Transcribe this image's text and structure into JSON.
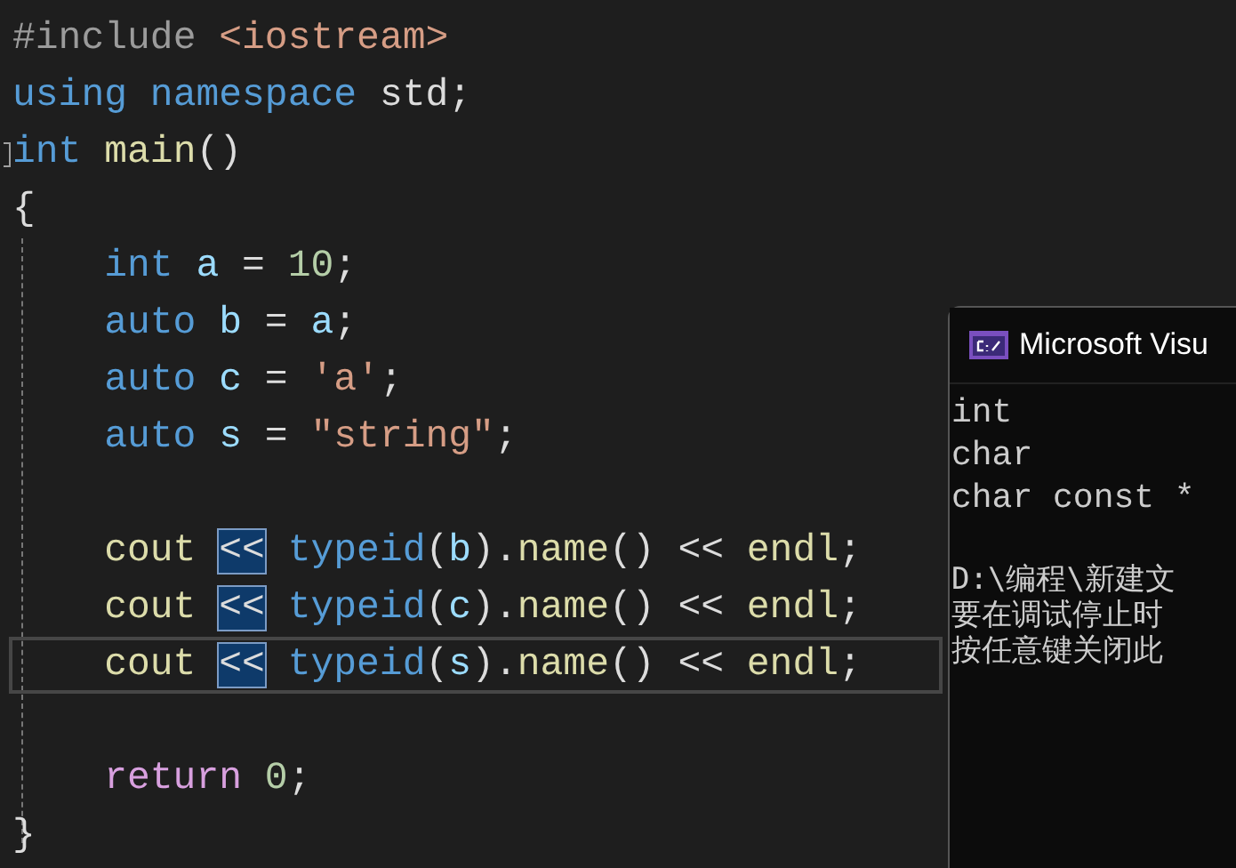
{
  "editor": {
    "lines": [
      {
        "current": false,
        "fold_marker": false,
        "indented": false,
        "tokens": [
          {
            "kind": "preproc",
            "text": "#include "
          },
          {
            "kind": "string",
            "text": "<iostream>"
          }
        ]
      },
      {
        "current": false,
        "fold_marker": false,
        "indented": false,
        "tokens": [
          {
            "kind": "keyword",
            "text": "using namespace "
          },
          {
            "kind": "plain",
            "text": "std;"
          }
        ]
      },
      {
        "current": false,
        "fold_marker": true,
        "indented": false,
        "tokens": [
          {
            "kind": "keyword",
            "text": "int "
          },
          {
            "kind": "function",
            "text": "main"
          },
          {
            "kind": "plain",
            "text": "()"
          }
        ]
      },
      {
        "current": false,
        "fold_marker": false,
        "indented": false,
        "tokens": [
          {
            "kind": "plain",
            "text": "{"
          }
        ]
      },
      {
        "current": false,
        "fold_marker": false,
        "indented": true,
        "tokens": [
          {
            "kind": "keyword",
            "text": "int "
          },
          {
            "kind": "variable",
            "text": "a"
          },
          {
            "kind": "plain",
            "text": " = "
          },
          {
            "kind": "number",
            "text": "10"
          },
          {
            "kind": "plain",
            "text": ";"
          }
        ]
      },
      {
        "current": false,
        "fold_marker": false,
        "indented": true,
        "tokens": [
          {
            "kind": "keyword",
            "text": "auto "
          },
          {
            "kind": "variable",
            "text": "b"
          },
          {
            "kind": "plain",
            "text": " = "
          },
          {
            "kind": "variable",
            "text": "a"
          },
          {
            "kind": "plain",
            "text": ";"
          }
        ]
      },
      {
        "current": false,
        "fold_marker": false,
        "indented": true,
        "tokens": [
          {
            "kind": "keyword",
            "text": "auto "
          },
          {
            "kind": "variable",
            "text": "c"
          },
          {
            "kind": "plain",
            "text": " = "
          },
          {
            "kind": "string",
            "text": "'a'"
          },
          {
            "kind": "plain",
            "text": ";"
          }
        ]
      },
      {
        "current": false,
        "fold_marker": false,
        "indented": true,
        "tokens": [
          {
            "kind": "keyword",
            "text": "auto "
          },
          {
            "kind": "variable",
            "text": "s"
          },
          {
            "kind": "plain",
            "text": " = "
          },
          {
            "kind": "string",
            "text": "\"string\""
          },
          {
            "kind": "plain",
            "text": ";"
          }
        ]
      },
      {
        "current": false,
        "fold_marker": false
      },
      {
        "current": false,
        "fold_marker": false,
        "indented": true,
        "tokens": [
          {
            "kind": "function",
            "text": "cout "
          },
          {
            "kind": "match",
            "text": "<<"
          },
          {
            "kind": "keyword",
            "text": " typeid"
          },
          {
            "kind": "plain",
            "text": "("
          },
          {
            "kind": "variable",
            "text": "b"
          },
          {
            "kind": "plain",
            "text": ")."
          },
          {
            "kind": "function",
            "text": "name"
          },
          {
            "kind": "plain",
            "text": "() << "
          },
          {
            "kind": "function",
            "text": "endl"
          },
          {
            "kind": "plain",
            "text": ";"
          }
        ]
      },
      {
        "current": false,
        "fold_marker": false,
        "indented": true,
        "tokens": [
          {
            "kind": "function",
            "text": "cout "
          },
          {
            "kind": "match",
            "text": "<<"
          },
          {
            "kind": "keyword",
            "text": " typeid"
          },
          {
            "kind": "plain",
            "text": "("
          },
          {
            "kind": "variable",
            "text": "c"
          },
          {
            "kind": "plain",
            "text": ")."
          },
          {
            "kind": "function",
            "text": "name"
          },
          {
            "kind": "plain",
            "text": "() << "
          },
          {
            "kind": "function",
            "text": "endl"
          },
          {
            "kind": "plain",
            "text": ";"
          }
        ]
      },
      {
        "current": true,
        "fold_marker": false,
        "indented": true,
        "tokens": [
          {
            "kind": "function",
            "text": "cout "
          },
          {
            "kind": "match",
            "text": "<<"
          },
          {
            "kind": "keyword",
            "text": " typeid"
          },
          {
            "kind": "plain",
            "text": "("
          },
          {
            "kind": "variable",
            "text": "s"
          },
          {
            "kind": "plain",
            "text": ")."
          },
          {
            "kind": "function",
            "text": "name"
          },
          {
            "kind": "plain",
            "text": "() << "
          },
          {
            "kind": "function",
            "text": "endl"
          },
          {
            "kind": "plain",
            "text": ";"
          }
        ]
      },
      {
        "current": false,
        "fold_marker": false
      },
      {
        "current": false,
        "fold_marker": false,
        "indented": true,
        "tokens": [
          {
            "kind": "control",
            "text": "return "
          },
          {
            "kind": "number",
            "text": "0"
          },
          {
            "kind": "plain",
            "text": ";"
          }
        ]
      },
      {
        "current": false,
        "fold_marker": false,
        "indented": false,
        "tokens": [
          {
            "kind": "plain",
            "text": "}"
          }
        ]
      }
    ]
  },
  "console": {
    "title": "Microsoft Visu",
    "output": [
      "int",
      "char",
      "char const *"
    ],
    "messages": [
      "D:\\编程\\新建文",
      "要在调试停止时",
      "按任意键关闭此"
    ]
  }
}
